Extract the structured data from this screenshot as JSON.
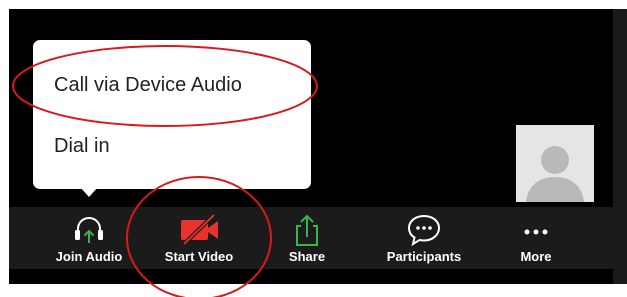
{
  "popup_menu": {
    "items": [
      {
        "label": "Call via Device Audio"
      },
      {
        "label": "Dial in"
      }
    ]
  },
  "self_view": {
    "avatar_icon": "person-silhouette-icon"
  },
  "toolbar": {
    "items": [
      {
        "label": "Join Audio",
        "icon": "headphones-icon"
      },
      {
        "label": "Start Video",
        "icon": "video-off-icon"
      },
      {
        "label": "Share",
        "icon": "share-icon"
      },
      {
        "label": "Participants",
        "icon": "chat-bubble-icon"
      },
      {
        "label": "More",
        "icon": "more-dots-icon"
      }
    ]
  },
  "colors": {
    "toolbar_bg": "#1b1b1b",
    "video_off_red": "#e8322d",
    "share_green": "#3bb54a",
    "annotation_red": "#d9191c"
  }
}
